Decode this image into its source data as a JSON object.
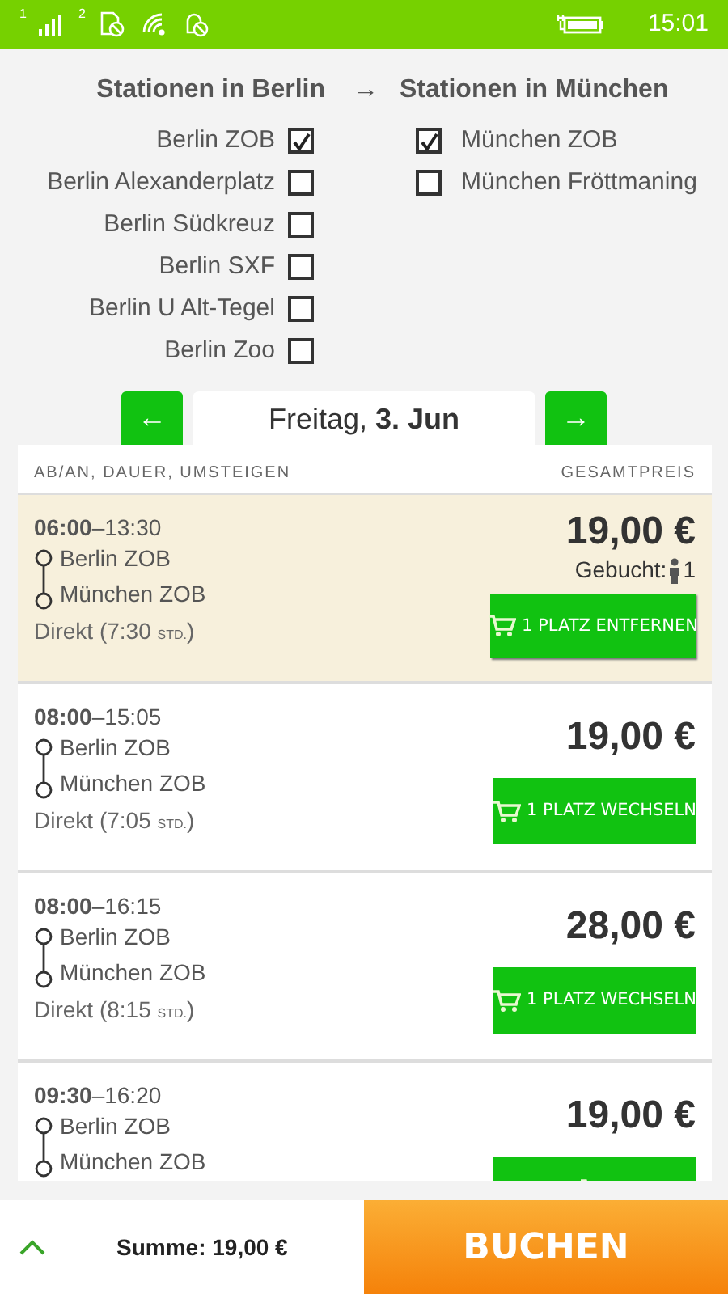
{
  "status_bar": {
    "sim1": "1",
    "sim2": "2",
    "time": "15:01"
  },
  "stations": {
    "from_title": "Stationen in Berlin",
    "arrow": "→",
    "to_title": "Stationen in München",
    "from": [
      {
        "label": "Berlin ZOB",
        "checked": true
      },
      {
        "label": "Berlin Alexanderplatz",
        "checked": false
      },
      {
        "label": "Berlin Südkreuz",
        "checked": false
      },
      {
        "label": "Berlin SXF",
        "checked": false
      },
      {
        "label": "Berlin U Alt-Tegel",
        "checked": false
      },
      {
        "label": "Berlin Zoo",
        "checked": false
      }
    ],
    "to": [
      {
        "label": "München ZOB",
        "checked": true
      },
      {
        "label": "München Fröttmaning",
        "checked": false
      }
    ]
  },
  "date_nav": {
    "prev": "←",
    "date": "Freitag, **3. Jun**",
    "next": "→"
  },
  "results": {
    "columns": [
      "AB/AN, DAUER, UMSTEIGEN",
      "GESAMTPREIS"
    ],
    "trips": [
      {
        "depart": "06:00",
        "dash": "–",
        "arrive": "13:30",
        "from": "Berlin ZOB",
        "to": "München ZOB",
        "duration": "Direkt (7:30",
        "unit": "STD.",
        "close": ")",
        "price": "19,00 €",
        "selected": true,
        "booked": {
          "label": "Gebucht:",
          "count": "1"
        },
        "button": "1 PLATZ ENTFERNEN"
      },
      {
        "depart": "08:00",
        "dash": "–",
        "arrive": "15:05",
        "from": "Berlin ZOB",
        "to": "München ZOB",
        "duration": "Direkt (7:05",
        "unit": "STD.",
        "close": ")",
        "price": "19,00 €",
        "selected": false,
        "button": "1 PLATZ WECHSELN"
      },
      {
        "depart": "08:00",
        "dash": "–",
        "arrive": "16:15",
        "from": "Berlin ZOB",
        "to": "München ZOB",
        "duration": "Direkt (8:15",
        "unit": "STD.",
        "close": ")",
        "price": "28,00 €",
        "selected": false,
        "button": "1 PLATZ WECHSELN"
      },
      {
        "depart": "09:30",
        "dash": "–",
        "arrive": "16:20",
        "from": "Berlin ZOB",
        "to": "München ZOB",
        "price": "19,00 €",
        "selected": false
      }
    ]
  },
  "footer": {
    "sum": "Summe: 19,00 €",
    "book": "BUCHEN"
  }
}
